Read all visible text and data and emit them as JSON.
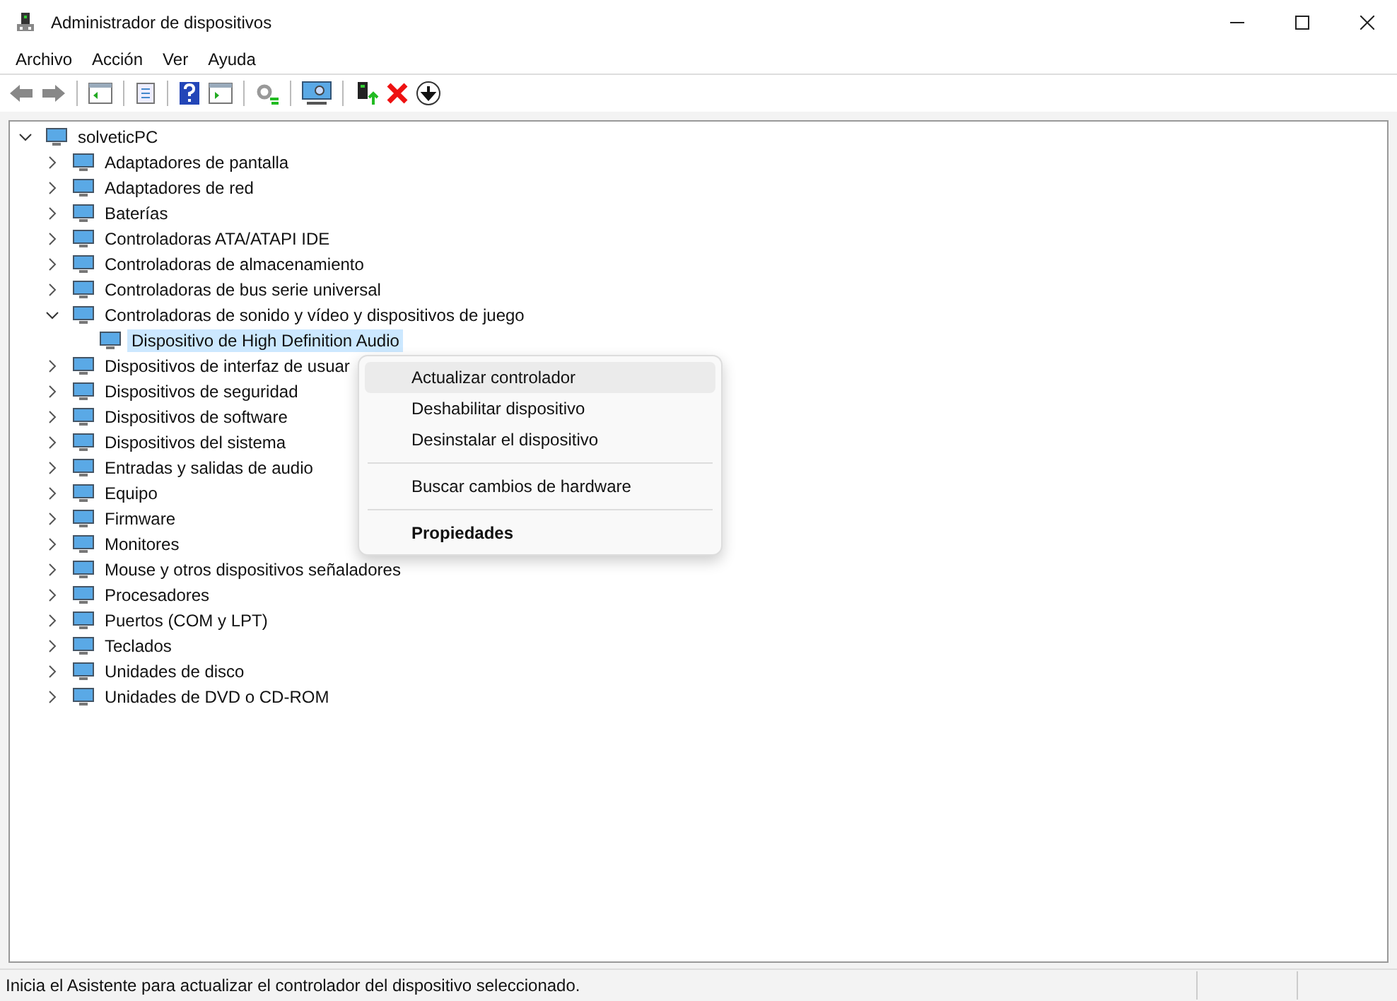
{
  "window": {
    "title": "Administrador de dispositivos"
  },
  "menu_bar": [
    "Archivo",
    "Acción",
    "Ver",
    "Ayuda"
  ],
  "tree": {
    "label": "solveticPC",
    "expanded": true,
    "children": [
      {
        "label": "Adaptadores de pantalla",
        "expanded": false
      },
      {
        "label": "Adaptadores de red",
        "expanded": false
      },
      {
        "label": "Baterías",
        "expanded": false
      },
      {
        "label": "Controladoras ATA/ATAPI IDE",
        "expanded": false
      },
      {
        "label": "Controladoras de almacenamiento",
        "expanded": false
      },
      {
        "label": "Controladoras de bus serie universal",
        "expanded": false
      },
      {
        "label": "Controladoras de sonido y vídeo y dispositivos de juego",
        "expanded": true,
        "children": [
          {
            "label": "Dispositivo de High Definition Audio",
            "selected": true
          }
        ]
      },
      {
        "label": "Dispositivos de interfaz de usuar",
        "expanded": false
      },
      {
        "label": "Dispositivos de seguridad",
        "expanded": false
      },
      {
        "label": "Dispositivos de software",
        "expanded": false
      },
      {
        "label": "Dispositivos del sistema",
        "expanded": false
      },
      {
        "label": "Entradas y salidas de audio",
        "expanded": false
      },
      {
        "label": "Equipo",
        "expanded": false
      },
      {
        "label": "Firmware",
        "expanded": false
      },
      {
        "label": "Monitores",
        "expanded": false
      },
      {
        "label": "Mouse y otros dispositivos señaladores",
        "expanded": false
      },
      {
        "label": "Procesadores",
        "expanded": false
      },
      {
        "label": "Puertos (COM y LPT)",
        "expanded": false
      },
      {
        "label": "Teclados",
        "expanded": false
      },
      {
        "label": "Unidades de disco",
        "expanded": false
      },
      {
        "label": "Unidades de DVD o CD-ROM",
        "expanded": false
      }
    ]
  },
  "context_menu": [
    {
      "kind": "item",
      "label": "Actualizar controlador",
      "highlighted": true
    },
    {
      "kind": "item",
      "label": "Deshabilitar dispositivo",
      "highlighted": false
    },
    {
      "kind": "item",
      "label": "Desinstalar el dispositivo",
      "highlighted": false
    },
    {
      "kind": "separator"
    },
    {
      "kind": "item",
      "label": "Buscar cambios de hardware",
      "highlighted": false
    },
    {
      "kind": "separator"
    },
    {
      "kind": "default",
      "label": "Propiedades",
      "highlighted": false
    }
  ],
  "status_bar": "Inicia el Asistente para actualizar el controlador del dispositivo seleccionado."
}
